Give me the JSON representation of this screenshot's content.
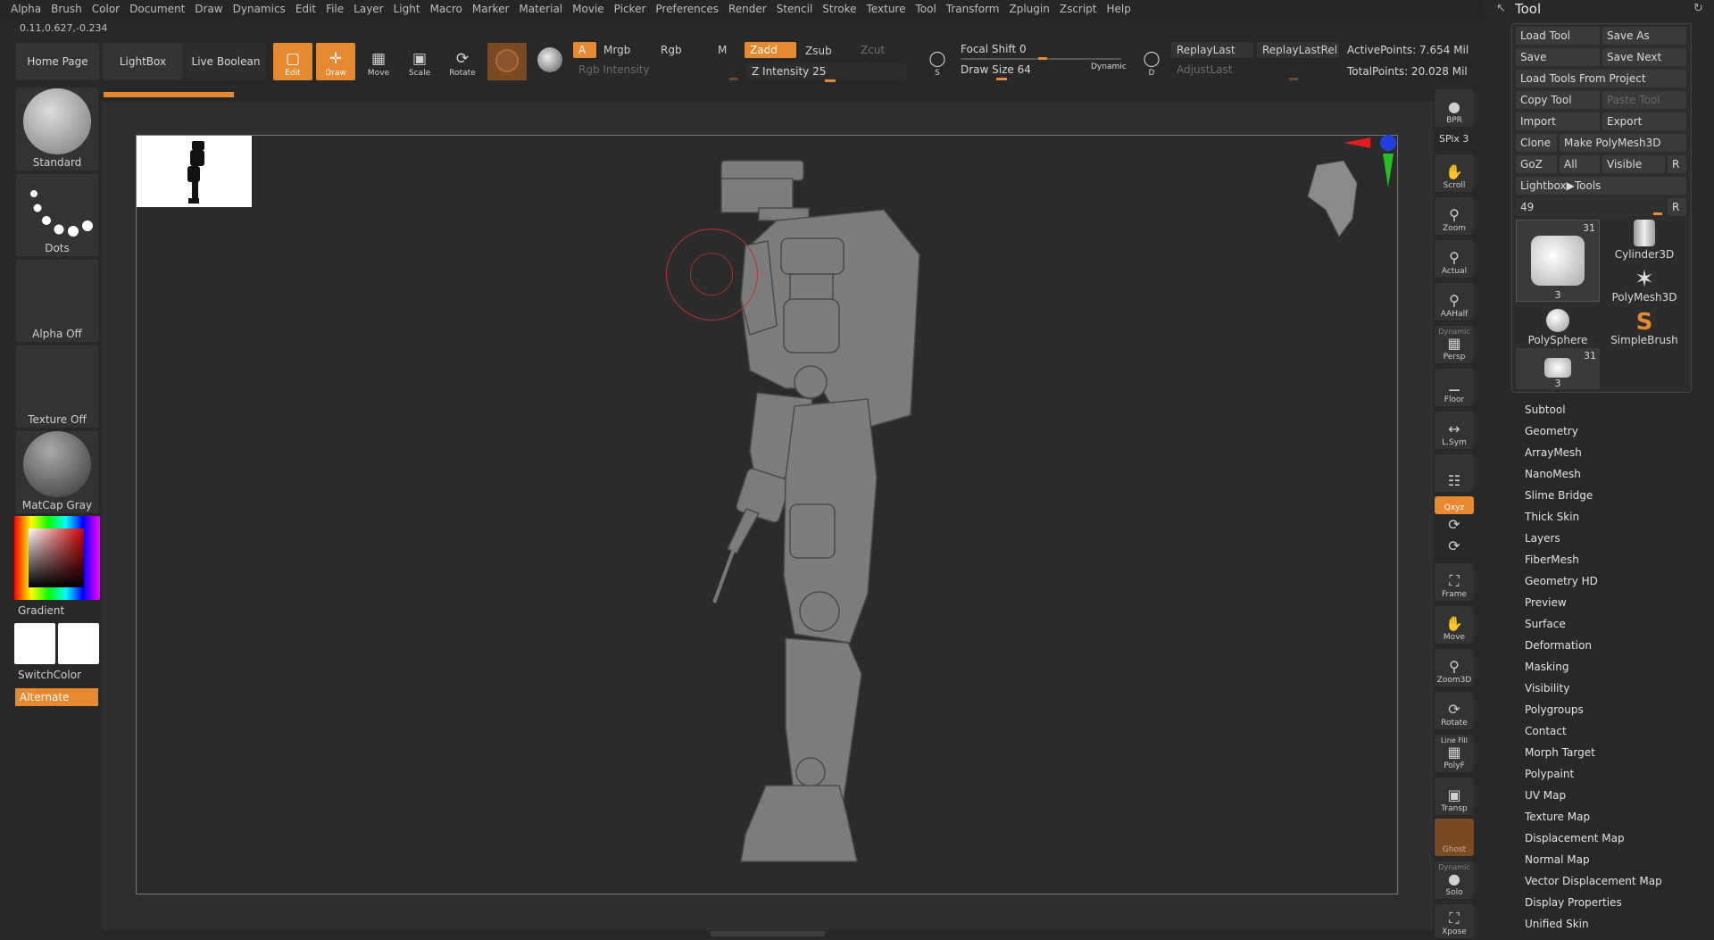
{
  "menu": [
    "Alpha",
    "Brush",
    "Color",
    "Document",
    "Draw",
    "Dynamics",
    "Edit",
    "File",
    "Layer",
    "Light",
    "Macro",
    "Marker",
    "Material",
    "Movie",
    "Picker",
    "Preferences",
    "Render",
    "Stencil",
    "Stroke",
    "Texture",
    "Tool",
    "Transform",
    "Zplugin",
    "Zscript",
    "Help"
  ],
  "coords": "0.11,0.627,-0.234",
  "shelf": {
    "home": "Home Page",
    "lightbox": "LightBox",
    "live_boolean": "Live Boolean",
    "edit": "Edit",
    "draw": "Draw",
    "move": "Move",
    "scale": "Scale",
    "rotate": "Rotate",
    "a": "A",
    "mrgb": "Mrgb",
    "rgb": "Rgb",
    "m": "M",
    "zadd": "Zadd",
    "zsub": "Zsub",
    "zcut": "Zcut",
    "rgb_intensity": "Rgb Intensity",
    "z_intensity": "Z Intensity 25",
    "focal_shift": "Focal Shift 0",
    "draw_size": "Draw Size 64",
    "dynamic": "Dynamic",
    "replay_last": "ReplayLast",
    "replay_last_rel": "ReplayLastRel",
    "adjust_last": "AdjustLast",
    "s": "S",
    "d": "D",
    "active_points": "ActivePoints: 7.654 Mil",
    "total_points": "TotalPoints: 20.028 Mil"
  },
  "left": {
    "brush": "Standard",
    "stroke": "Dots",
    "alpha": "Alpha Off",
    "texture": "Texture Off",
    "material": "MatCap Gray",
    "gradient": "Gradient",
    "switch_color": "SwitchColor",
    "alternate": "Alternate"
  },
  "right_shelf": {
    "bpr": "BPR",
    "spix": "SPix 3",
    "scroll": "Scroll",
    "zoom": "Zoom",
    "actual": "Actual",
    "aahalf": "AAHalf",
    "dynamic": "Dynamic",
    "persp": "Persp",
    "floor": "Floor",
    "lsym": "L.Sym",
    "xyz": "Qxyz",
    "frame": "Frame",
    "move": "Move",
    "zoom3d": "Zoom3D",
    "rotate": "Rotate",
    "linefill": "Line Fill",
    "polyf": "PolyF",
    "transp": "Transp",
    "ghost": "Ghost",
    "dynamic2": "Dynamic",
    "solo": "Solo",
    "xpose": "Xpose"
  },
  "tool": {
    "title": "Tool",
    "load_tool": "Load Tool",
    "save_as": "Save As",
    "save": "Save",
    "save_next": "Save Next",
    "load_from_project": "Load Tools From Project",
    "copy_tool": "Copy Tool",
    "paste_tool": "Paste Tool",
    "import": "Import",
    "export": "Export",
    "clone": "Clone",
    "make_polymesh": "Make PolyMesh3D",
    "goz": "GoZ",
    "all": "All",
    "visible": "Visible",
    "r": "R",
    "lightbox_tools": "Lightbox▶Tools",
    "slider_value": "49",
    "tiles": [
      {
        "label": "3",
        "badge": "31"
      },
      {
        "label": "Cylinder3D"
      },
      {
        "label": "PolyMesh3D"
      },
      {
        "label": "PolySphere"
      },
      {
        "label": "SimpleBrush"
      },
      {
        "label": "3",
        "badge": "31"
      }
    ],
    "subpalettes": [
      "Subtool",
      "Geometry",
      "ArrayMesh",
      "NanoMesh",
      "Slime Bridge",
      "Thick Skin",
      "Layers",
      "FiberMesh",
      "Geometry HD",
      "Preview",
      "Surface",
      "Deformation",
      "Masking",
      "Visibility",
      "Polygroups",
      "Contact",
      "Morph Target",
      "Polypaint",
      "UV Map",
      "Texture Map",
      "Displacement Map",
      "Normal Map",
      "Vector Displacement Map",
      "Display Properties",
      "Unified Skin"
    ]
  },
  "colors": {
    "accent": "#e8882f",
    "panel": "#333333",
    "bg": "#282828"
  },
  "icons": [
    "edit-icon",
    "draw-icon",
    "move-icon",
    "scale-icon",
    "rotate-icon",
    "material-sphere-icon",
    "gizmo-icon"
  ]
}
